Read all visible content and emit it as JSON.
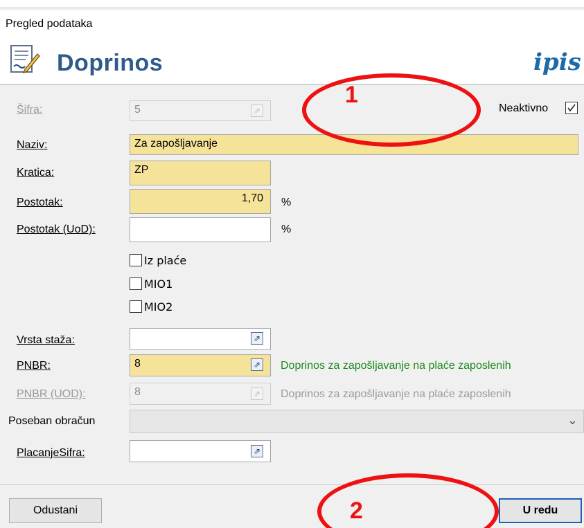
{
  "window": {
    "title": "Pregled podataka"
  },
  "header": {
    "title": "Doprinos",
    "logo_text": "ipis",
    "icon": "document-edit-icon"
  },
  "form": {
    "sifra": {
      "label": "Šifra:",
      "value": "5"
    },
    "neaktivno": {
      "label": "Neaktivno",
      "checked": true
    },
    "naziv": {
      "label": "Naziv:",
      "value": "Za zapošljavanje"
    },
    "kratica": {
      "label": "Kratica:",
      "value": "ZP"
    },
    "postotak": {
      "label": "Postotak:",
      "value": "1,70",
      "unit": "%"
    },
    "postotak_uod": {
      "label": "Postotak (UoD):",
      "value": "",
      "unit": "%"
    },
    "checkboxes": [
      {
        "label": "Iz plaće",
        "checked": false
      },
      {
        "label": "MIO1",
        "checked": false
      },
      {
        "label": "MIO2",
        "checked": false
      }
    ],
    "vrsta_staza": {
      "label": "Vrsta staža:",
      "value": ""
    },
    "pnbr": {
      "label": "PNBR:",
      "value": "8",
      "hint": "Doprinos za zapošljavanje na plaće zaposlenih"
    },
    "pnbr_uod": {
      "label": "PNBR (UOD):",
      "value": "8",
      "hint": "Doprinos za zapošljavanje na plaće zaposlenih"
    },
    "poseban_obracun": {
      "label": "Poseban obračun",
      "value": ""
    },
    "placanje_sifra": {
      "label": "PlacanjeSifra:",
      "value": ""
    }
  },
  "buttons": {
    "cancel": "Odustani",
    "ok": "U redu"
  },
  "annotations": {
    "marker_1": "1",
    "marker_2": "2",
    "color": "#ee1111"
  },
  "colors": {
    "required_field": "#f6e39a",
    "title_blue": "#2e5a8c",
    "hint_green": "#1b8a1b"
  }
}
